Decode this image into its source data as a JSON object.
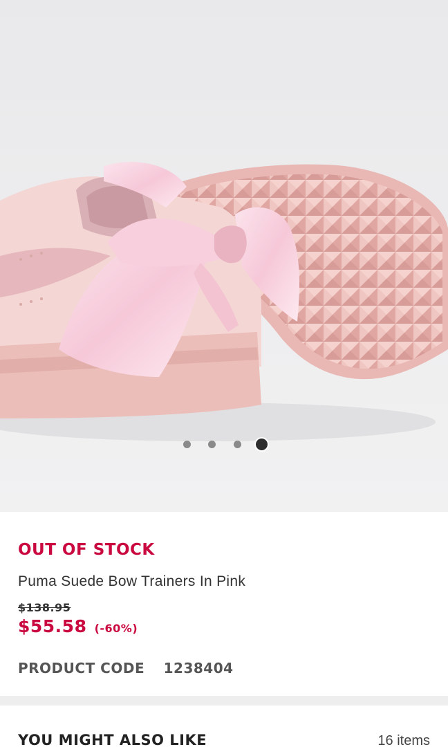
{
  "product": {
    "image_alt": "Pink satin bow suede trainers",
    "carousel": {
      "total_slides": 4,
      "active_slide": 4
    },
    "stock_status": "OUT OF STOCK",
    "name": "Puma Suede Bow Trainers In Pink",
    "original_price": "$138.95",
    "sale_price": "$55.58",
    "discount": "(-60%)",
    "code_label": "PRODUCT CODE",
    "code_value": "1238404"
  },
  "recommendations": {
    "title": "YOU MIGHT ALSO LIKE",
    "count": "16 items"
  },
  "colors": {
    "accent": "#c9093f",
    "image_background": "#ececee",
    "shoe_pink": "#f2cfcf",
    "sole_pink": "#ecbcb8"
  }
}
